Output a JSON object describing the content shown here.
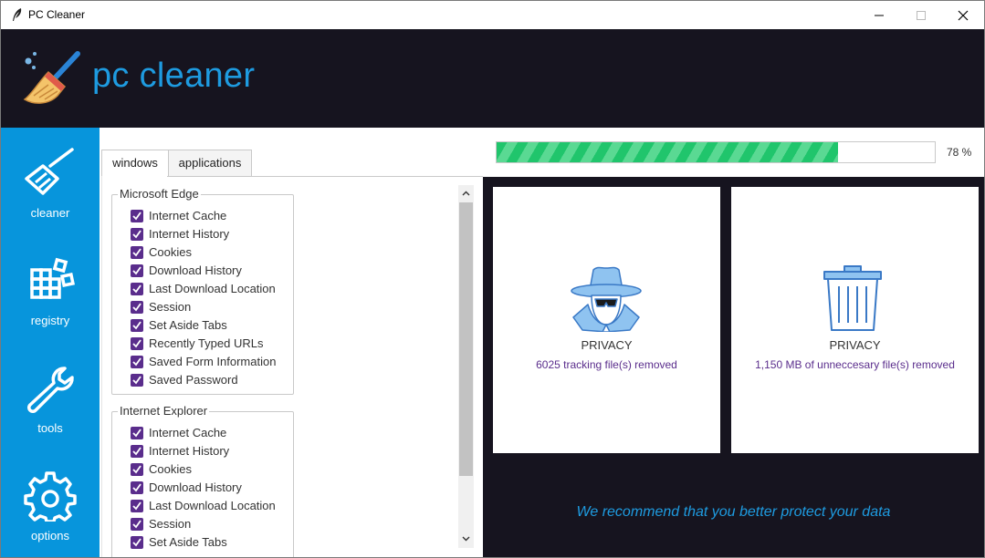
{
  "window": {
    "title": "PC Cleaner"
  },
  "header": {
    "brand": "pc cleaner"
  },
  "sidebar": {
    "items": [
      {
        "label": "cleaner",
        "icon": "broom-icon"
      },
      {
        "label": "registry",
        "icon": "registry-blocks-icon"
      },
      {
        "label": "tools",
        "icon": "wrench-icon"
      },
      {
        "label": "options",
        "icon": "gear-icon"
      }
    ]
  },
  "tabs": [
    {
      "label": "windows"
    },
    {
      "label": "applications"
    }
  ],
  "groups": [
    {
      "title": "Microsoft Edge",
      "items": [
        "Internet Cache",
        "Internet History",
        "Cookies",
        "Download History",
        "Last Download Location",
        "Session",
        "Set Aside Tabs",
        "Recently Typed URLs",
        "Saved Form Information",
        "Saved Password"
      ]
    },
    {
      "title": "Internet Explorer",
      "items": [
        "Internet Cache",
        "Internet History",
        "Cookies",
        "Download History",
        "Last Download Location",
        "Session",
        "Set Aside Tabs"
      ]
    }
  ],
  "progress": {
    "value": 0.78,
    "label": "78 %"
  },
  "cards": [
    {
      "title": "PRIVACY",
      "desc": "6025 tracking file(s) removed",
      "icon": "spy-icon"
    },
    {
      "title": "PRIVACY",
      "desc": "1,150 MB of unneccesary file(s) removed",
      "icon": "trash-icon"
    }
  ],
  "recommendation": "We recommend that you better protect your data",
  "colors": {
    "accent": "#1e9be0",
    "sidebar": "#0795dc",
    "dark": "#16141f",
    "checkbox": "#5a2d8c",
    "progress": "#20c56c"
  }
}
